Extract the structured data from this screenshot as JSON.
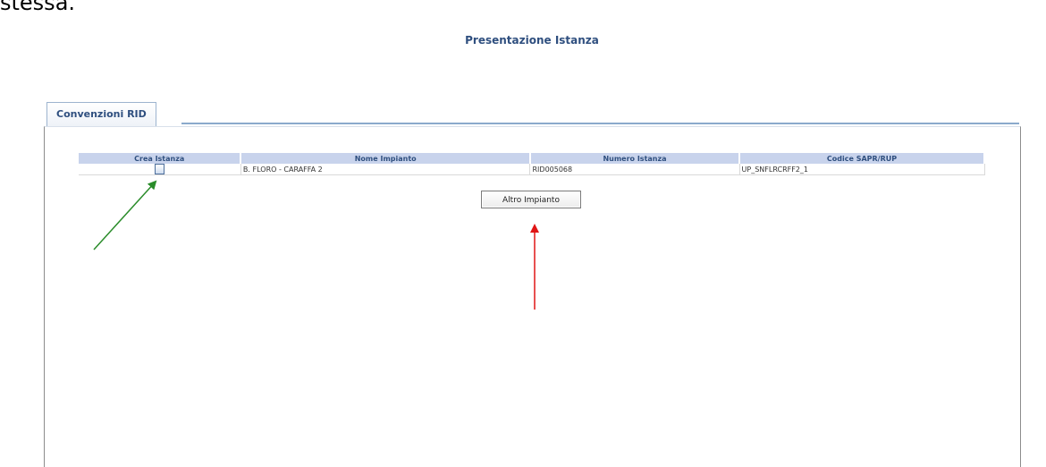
{
  "doc_fragment": "stessa.",
  "page_heading": "Presentazione Istanza",
  "tab": {
    "label": "Convenzioni RID"
  },
  "table": {
    "headers": [
      "Crea Istanza",
      "Nome Impianto",
      "Numero Istanza",
      "Codice SAPR/RUP"
    ],
    "rows": [
      {
        "icon": "document-icon",
        "nome_impianto": "B. FLORO - CARAFFA 2",
        "numero_istanza": "RID005068",
        "codice": "UP_SNFLRCRFF2_1"
      }
    ]
  },
  "altro_button": {
    "label": "Altro Impianto"
  },
  "annotations": [
    {
      "type": "arrow",
      "color": "#2a8c2a",
      "target": "crea-istanza-icon"
    },
    {
      "type": "arrow",
      "color": "#e01515",
      "target": "altro-impianto-button"
    }
  ]
}
